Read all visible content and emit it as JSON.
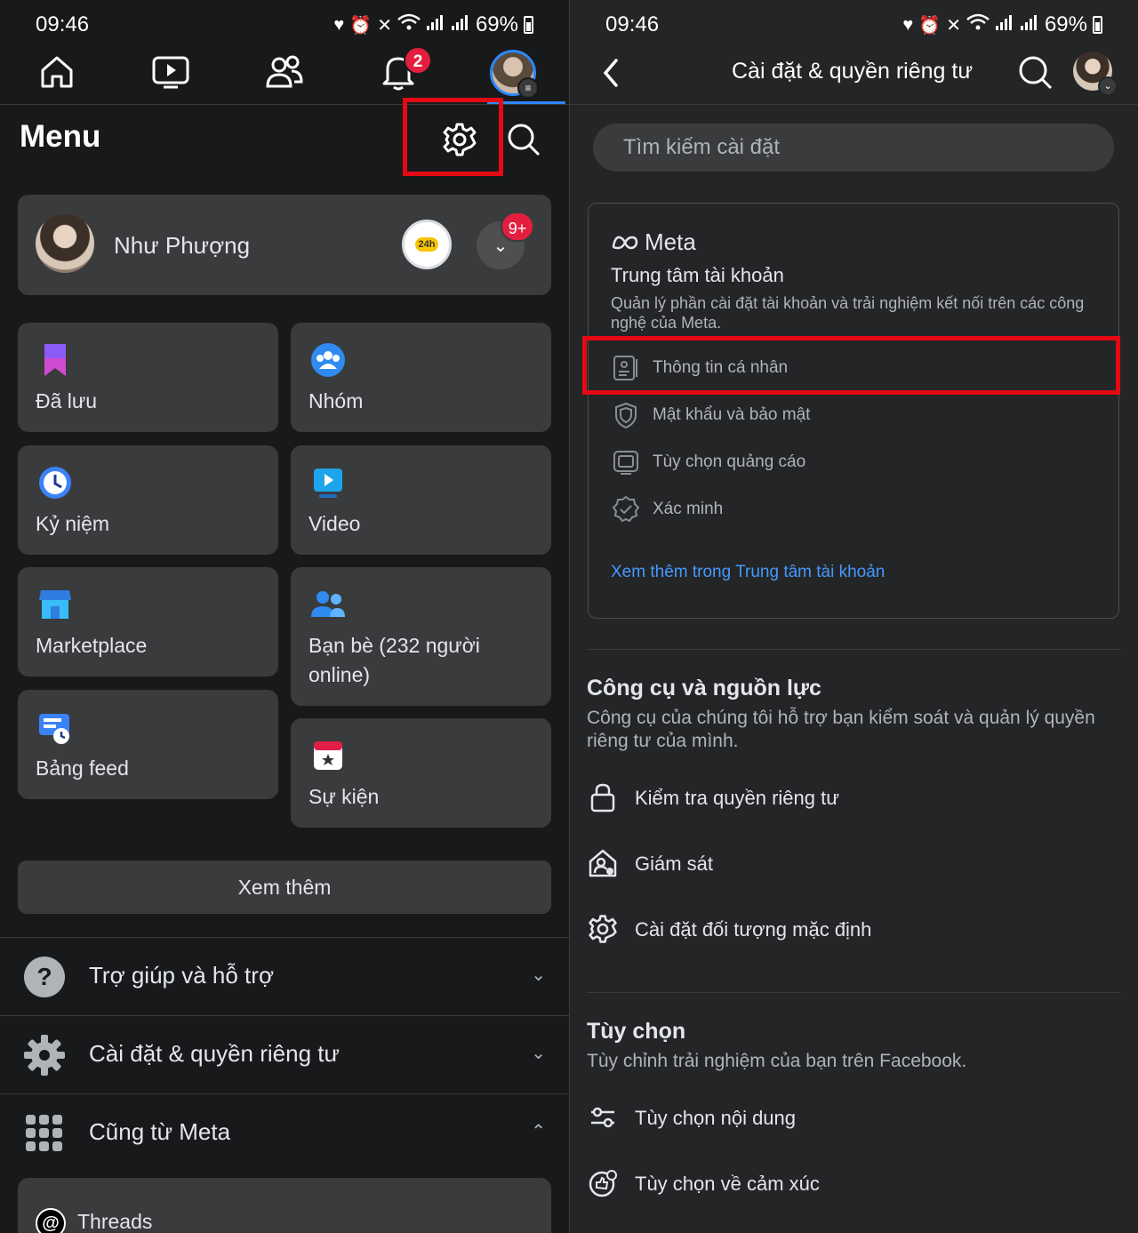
{
  "left": {
    "status_bar": {
      "time": "09:46",
      "battery": "69%"
    },
    "nav": {
      "notifications_badge": "2"
    },
    "menu_title": "Menu",
    "profile": {
      "name": "Như Phượng",
      "story_badge": "24h",
      "notifications_badge": "9+"
    },
    "shortcuts_col1": [
      {
        "label": "Đã lưu",
        "icon": "bookmark-icon"
      },
      {
        "label": "Kỷ niệm",
        "icon": "memories-icon"
      },
      {
        "label": "Marketplace",
        "icon": "marketplace-icon"
      },
      {
        "label": "Bảng feed",
        "icon": "feeds-icon"
      }
    ],
    "shortcuts_col2": [
      {
        "label": "Nhóm",
        "icon": "groups-icon"
      },
      {
        "label": "Video",
        "icon": "video-icon"
      },
      {
        "label": "Bạn bè (232 người online)",
        "icon": "friends-icon"
      },
      {
        "label": "Sự kiện",
        "icon": "events-icon"
      }
    ],
    "see_more": "Xem thêm",
    "accordion": [
      {
        "label": "Trợ giúp và hỗ trợ",
        "icon": "help-icon",
        "expanded": false
      },
      {
        "label": "Cài đặt & quyền riêng tư",
        "icon": "settings-gear-icon",
        "expanded": false
      },
      {
        "label": "Cũng từ Meta",
        "icon": "apps-grid-icon",
        "expanded": true
      }
    ],
    "meta_apps": [
      {
        "label": "Threads",
        "icon": "threads-icon"
      }
    ]
  },
  "right": {
    "status_bar": {
      "time": "09:46",
      "battery": "69%"
    },
    "header_title": "Cài đặt & quyền riêng tư",
    "search_placeholder": "Tìm kiếm cài đặt",
    "meta_card": {
      "logo_text": "Meta",
      "title": "Trung tâm tài khoản",
      "description": "Quản lý phần cài đặt tài khoản và trải nghiệm kết nối trên các công nghệ của Meta.",
      "items": [
        {
          "label": "Thông tin cá nhân",
          "icon": "id-card-icon"
        },
        {
          "label": "Mật khẩu và bảo mật",
          "icon": "shield-icon"
        },
        {
          "label": "Tùy chọn quảng cáo",
          "icon": "ad-monitor-icon"
        },
        {
          "label": "Xác minh",
          "icon": "verified-badge-icon"
        }
      ],
      "link": "Xem thêm trong Trung tâm tài khoản"
    },
    "tools": {
      "title": "Công cụ và nguồn lực",
      "description": "Công cụ của chúng tôi hỗ trợ bạn kiểm soát và quản lý quyền riêng tư của mình.",
      "items": [
        {
          "label": "Kiểm tra quyền riêng tư",
          "icon": "lock-icon"
        },
        {
          "label": "Giám sát",
          "icon": "supervision-icon"
        },
        {
          "label": "Cài đặt đối tượng mặc định",
          "icon": "gear-icon"
        }
      ]
    },
    "preferences": {
      "title": "Tùy chọn",
      "description": "Tùy chỉnh trải nghiệm của bạn trên Facebook.",
      "items": [
        {
          "label": "Tùy chọn nội dung",
          "icon": "sliders-icon"
        },
        {
          "label": "Tùy chọn về cảm xúc",
          "icon": "reactions-icon"
        }
      ]
    }
  },
  "colors": {
    "accent": "#2d88ff",
    "highlight_box": "#e50914",
    "badge": "#e41e3f",
    "link": "#4599ff"
  }
}
